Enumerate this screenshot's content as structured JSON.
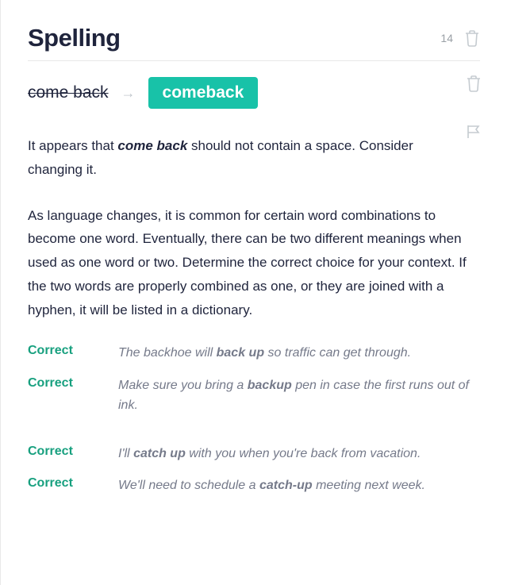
{
  "header": {
    "title": "Spelling",
    "count": "14"
  },
  "correction": {
    "original": "come back",
    "suggested": "comeback"
  },
  "explanation": {
    "pre": "It appears that ",
    "highlight": "come back",
    "post": " should not contain a space. Consider changing it."
  },
  "detail": "As language changes, it is common for certain word combinations to become one word. Eventually, there can be two different meanings when used as one word or two. Determine the correct choice for your context. If the two words are properly combined as one, or they are joined with a hyphen, it will be listed in a dictionary.",
  "examples": [
    [
      {
        "label": "Correct",
        "pre": "The backhoe will ",
        "bold": "back up",
        "post": " so traffic can get through."
      },
      {
        "label": "Correct",
        "pre": "Make sure you bring a ",
        "bold": "backup",
        "post": " pen in case the first runs out of ink."
      }
    ],
    [
      {
        "label": "Correct",
        "pre": "I'll ",
        "bold": "catch up",
        "post": " with you when you're back from vacation."
      },
      {
        "label": "Correct",
        "pre": "We'll need to schedule a ",
        "bold": "catch-up",
        "post": " meeting next week."
      }
    ]
  ]
}
